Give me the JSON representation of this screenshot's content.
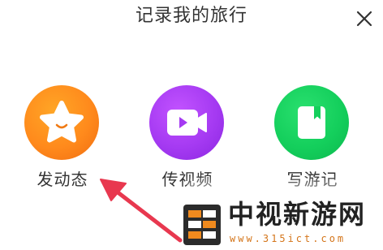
{
  "header": {
    "title": "记录我的旅行",
    "close_icon": "close-icon"
  },
  "options": [
    {
      "label": "发动态",
      "icon": "star-smile-icon",
      "color": "#ff8a1c"
    },
    {
      "label": "传视频",
      "icon": "video-camera-icon",
      "color": "#a53af2"
    },
    {
      "label": "写游记",
      "icon": "notebook-icon",
      "color": "#14cf5c"
    }
  ],
  "annotation": {
    "arrow_color": "#e8384f",
    "arrow_icon": "pointer-arrow-icon"
  },
  "watermark": {
    "text": "中视新游网",
    "url": "www.315ict.com",
    "logo_icon": "site-logo-icon",
    "url_color": "#d4751a"
  }
}
